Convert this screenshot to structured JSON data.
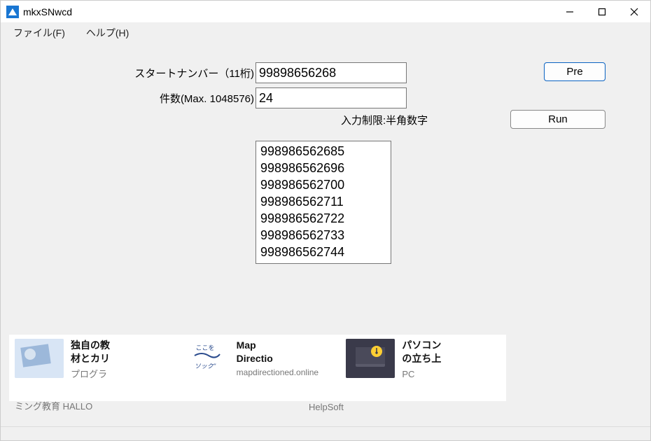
{
  "window": {
    "title": "mkxSNwcd"
  },
  "menu": {
    "file": "ファイル(F)",
    "help": "ヘルプ(H)"
  },
  "labels": {
    "start_number": "スタートナンバー（11桁)",
    "count": "件数(Max. 1048576)",
    "input_hint": "入力制限:半角数字"
  },
  "inputs": {
    "start_number": "99898656268",
    "count": "24"
  },
  "buttons": {
    "pre": "Pre",
    "run": "Run"
  },
  "results": [
    "998986562685",
    "998986562696",
    "998986562700",
    "998986562711",
    "998986562722",
    "998986562733",
    "998986562744"
  ],
  "ads": {
    "items": [
      {
        "title1": "独自の教",
        "title2": "材とカリ",
        "sub": "プログラ",
        "truncated": "ミング教育 HALLO"
      },
      {
        "title1": "Map",
        "title2": "Directio",
        "sub": "",
        "domain": "mapdirectioned.online"
      },
      {
        "title1": "パソコン",
        "title2": "の立ち上",
        "sub": "PC",
        "truncated": "HelpSoft"
      }
    ]
  }
}
